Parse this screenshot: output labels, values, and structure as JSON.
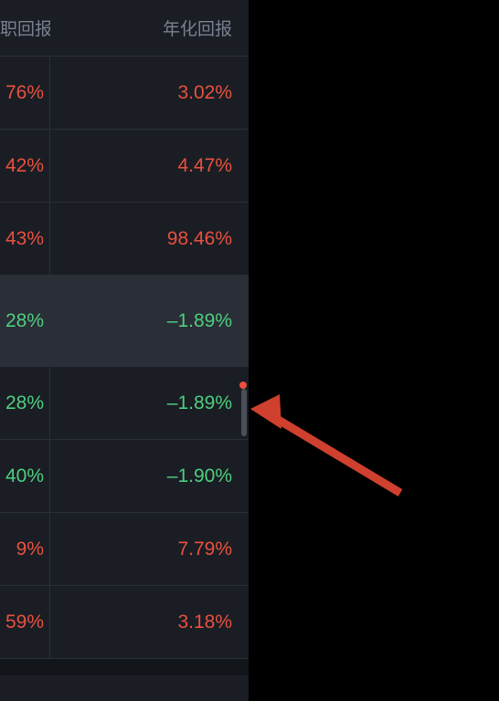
{
  "headers": {
    "col1": "职回报",
    "col2": "年化回报"
  },
  "rows": [
    {
      "left": "76%",
      "right": "3.02%",
      "leftClass": "positive",
      "rightClass": "positive",
      "highlighted": false
    },
    {
      "left": "42%",
      "right": "4.47%",
      "leftClass": "positive",
      "rightClass": "positive",
      "highlighted": false
    },
    {
      "left": "43%",
      "right": "98.46%",
      "leftClass": "positive",
      "rightClass": "positive",
      "highlighted": false
    },
    {
      "left": "28%",
      "right": "–1.89%",
      "leftClass": "negative",
      "rightClass": "negative",
      "highlighted": true
    },
    {
      "left": "28%",
      "right": "–1.89%",
      "leftClass": "negative",
      "rightClass": "negative",
      "highlighted": false
    },
    {
      "left": "40%",
      "right": "–1.90%",
      "leftClass": "negative",
      "rightClass": "negative",
      "highlighted": false
    },
    {
      "left": "9%",
      "right": "7.79%",
      "leftClass": "positive",
      "rightClass": "positive",
      "highlighted": false
    },
    {
      "left": "59%",
      "right": "3.18%",
      "leftClass": "positive",
      "rightClass": "positive",
      "highlighted": false
    }
  ],
  "colors": {
    "positive": "#e8513e",
    "negative": "#4fce7f"
  }
}
